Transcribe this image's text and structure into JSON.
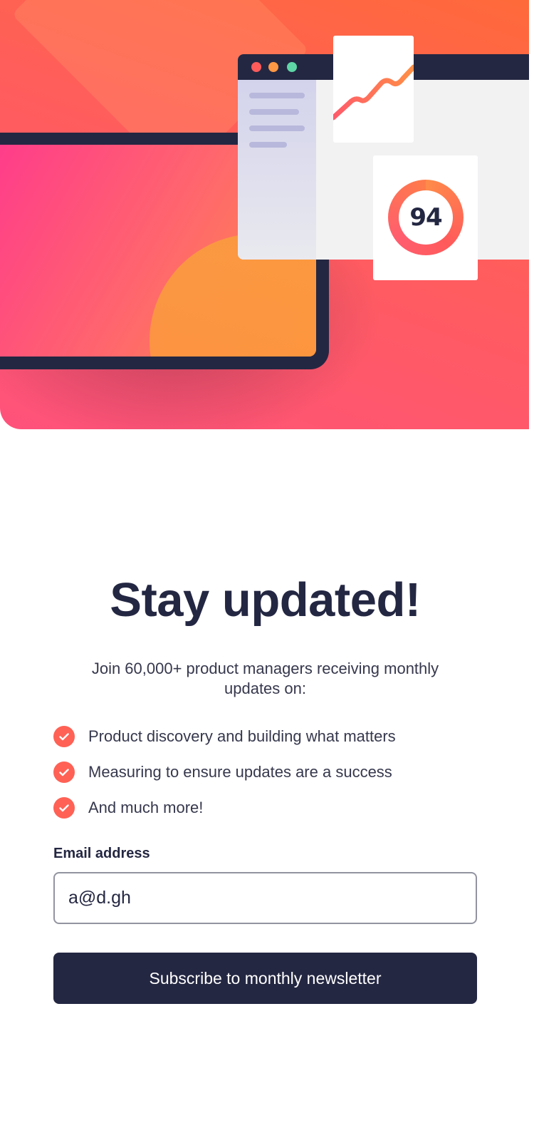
{
  "hero": {
    "score_value": "94",
    "icons": [
      "laptop-illustration",
      "browser-window-illustration",
      "line-chart-icon",
      "score-ring-icon"
    ]
  },
  "signup": {
    "title": "Stay updated!",
    "subtitle": "Join 60,000+ product managers receiving monthly updates on:",
    "features": [
      "Product discovery and building what matters",
      "Measuring to ensure updates are a success",
      "And much more!"
    ],
    "email_label": "Email address",
    "email_value": "a@d.gh",
    "submit_label": "Subscribe to monthly newsletter"
  },
  "colors": {
    "navy": "#242742",
    "tomato": "#ff6155",
    "text": "#36384d",
    "white": "#ffffff"
  }
}
